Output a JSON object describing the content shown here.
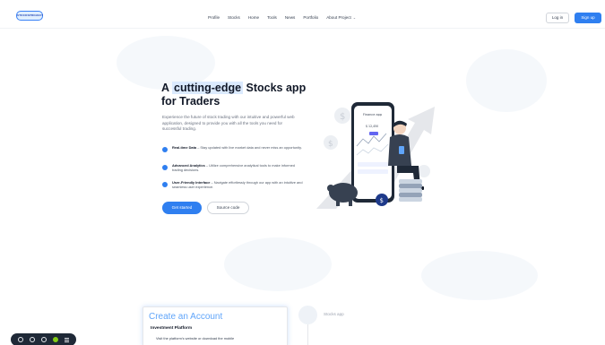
{
  "nav": {
    "logo_text": "STOCKSPROJECT",
    "items": [
      "Profile",
      "Stocks",
      "Home",
      "Tools",
      "News",
      "Portfolio",
      "About Project"
    ],
    "login_label": "Log in",
    "signup_label": "Sign up"
  },
  "hero": {
    "title_pre": "A ",
    "title_highlight": "cutting-edge",
    "title_post": " Stocks app for Traders",
    "description": "Experience the future of stock trading with our intuitive and powerful web application, designed to provide you with all the tools you need for successful trading.",
    "features": [
      {
        "title": "Real-time Data",
        "text": " – Stay updated with live market data and never miss an opportunity."
      },
      {
        "title": "Advanced Analytics",
        "text": " – Utilize comprehensive analytical tools to make informed trading decisions."
      },
      {
        "title": "User-Friendly Interface",
        "text": " – Navigate effortlessly through our app with an intuitive and seamless user experience."
      }
    ],
    "primary_button": "Get started",
    "secondary_button": "Source code"
  },
  "illustration": {
    "phone_header": "Finance app",
    "phone_amount": "$ 12,450"
  },
  "steps": {
    "card_title": "Create an Account",
    "card_subtitle": "Investment Platform",
    "card_text": "Visit the platform's website or download the mobile",
    "next_step_label": "Stocks app"
  },
  "colors": {
    "accent": "#2f7ff0",
    "highlight": "#dbeafe"
  }
}
